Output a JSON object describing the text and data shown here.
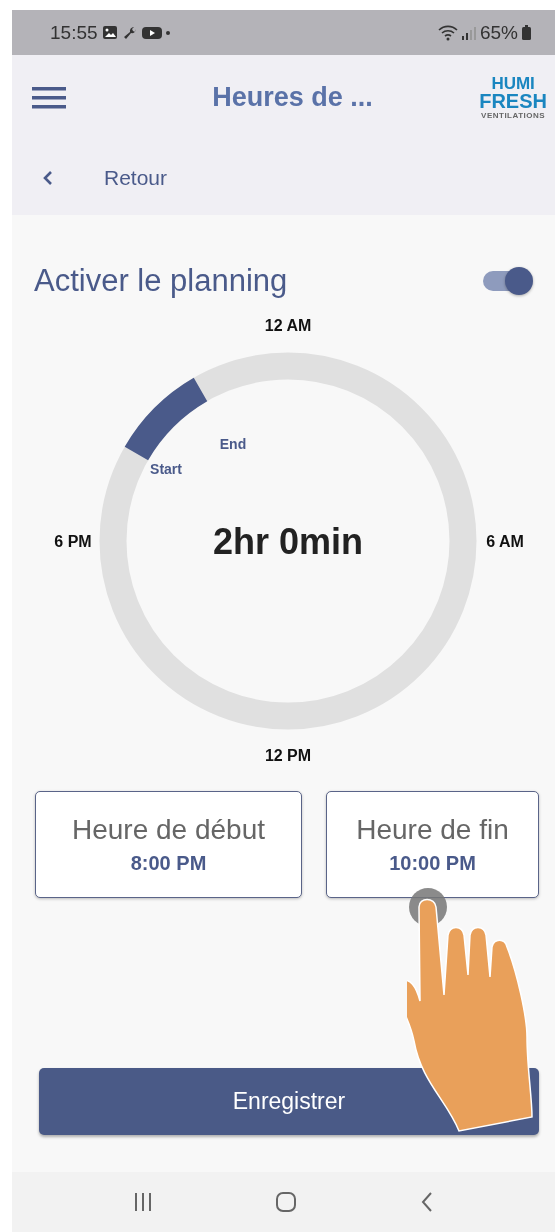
{
  "status_bar": {
    "time": "15:55",
    "battery": "65%"
  },
  "app_bar": {
    "title": "Heures de ...",
    "logo": {
      "line_1": "HUMI",
      "line_2": "FRESH",
      "tagline": "VENTILATIONS"
    }
  },
  "back_link": {
    "label": "Retour"
  },
  "schedule": {
    "title": "Activer le planning",
    "on": true
  },
  "dial": {
    "labels": [
      "12 AM",
      "6 AM",
      "12 PM",
      "6 PM"
    ],
    "start_label": "Start",
    "end_label": "End",
    "duration": "2hr 0min",
    "level": 0.0833
  },
  "times": [
    {
      "label": "Heure de début",
      "value": "8:00 PM"
    },
    {
      "label": "Heure de fin",
      "value": "10:00 PM"
    }
  ],
  "save_button": {
    "label": "Enregistrer"
  }
}
